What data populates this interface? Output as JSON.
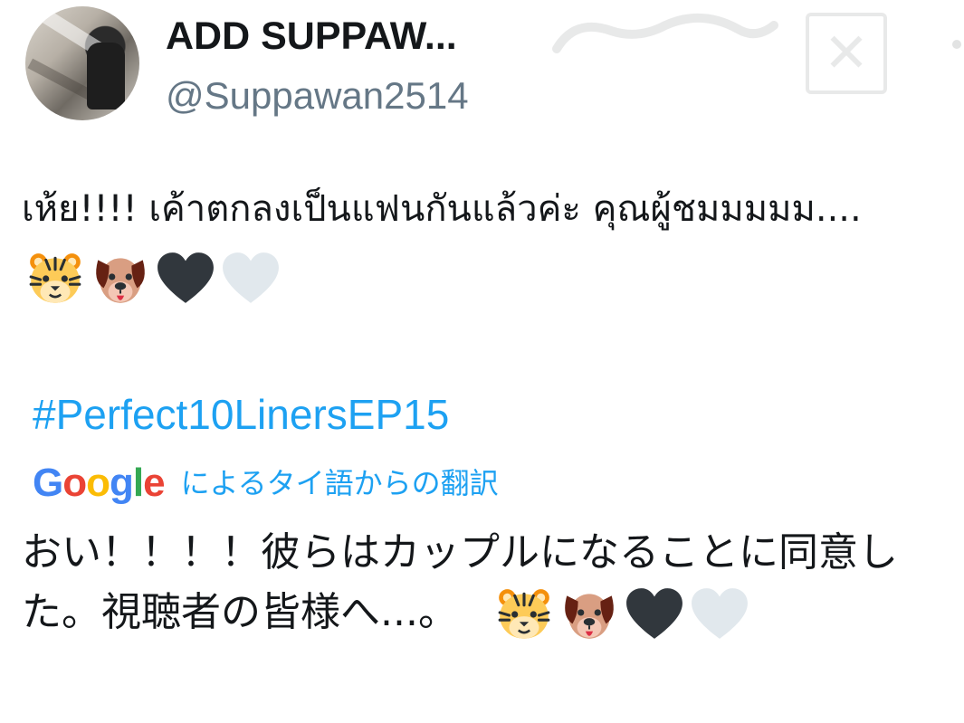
{
  "profile": {
    "display_name": "ADD SUPPAW...",
    "handle": "@Suppawan2514"
  },
  "tweet": {
    "text": "เห้ย!!!! เค้าตกลงเป็นแฟนกันแล้วค่ะ  คุณผู้ชมมมมม....",
    "emojis": [
      "tiger-face-icon",
      "dog-face-icon",
      "black-heart-icon",
      "white-heart-icon"
    ],
    "hashtag": "#Perfect10LinersEP15"
  },
  "translation": {
    "provider_letters": [
      "G",
      "o",
      "o",
      "g",
      "l",
      "e"
    ],
    "label": "によるタイ語からの翻訳",
    "text": "おい！！！！彼らはカップルになることに同意した。視聴者の皆様へ...。",
    "emojis": [
      "tiger-face-icon",
      "dog-face-icon",
      "black-heart-icon",
      "white-heart-icon"
    ]
  },
  "colors": {
    "link": "#1da1f2",
    "secondary_text": "#657786",
    "primary_text": "#14171a"
  }
}
